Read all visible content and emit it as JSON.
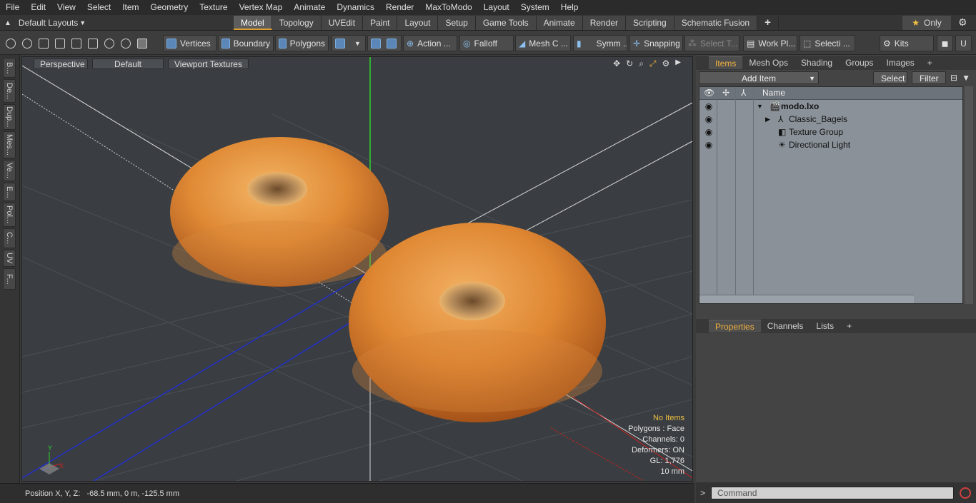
{
  "menu": [
    "File",
    "Edit",
    "View",
    "Select",
    "Item",
    "Geometry",
    "Texture",
    "Vertex Map",
    "Animate",
    "Dynamics",
    "Render",
    "MaxToModo",
    "Layout",
    "System",
    "Help"
  ],
  "layouts_label": "Default Layouts",
  "tabs": [
    {
      "label": "Model",
      "active": true
    },
    {
      "label": "Topology"
    },
    {
      "label": "UVEdit"
    },
    {
      "label": "Paint"
    },
    {
      "label": "Layout"
    },
    {
      "label": "Setup"
    },
    {
      "label": "Game Tools"
    },
    {
      "label": "Animate"
    },
    {
      "label": "Render"
    },
    {
      "label": "Scripting"
    },
    {
      "label": "Schematic Fusion"
    }
  ],
  "only_label": "Only",
  "toolbar": {
    "vertices": "Vertices",
    "boundary": "Boundary",
    "polygons": "Polygons",
    "action": "Action ...",
    "falloff": "Falloff",
    "mesh": "Mesh C ...",
    "symm": "Symm ...",
    "snapping": "Snapping",
    "select_t": "Select T...",
    "work_pl": "Work Pl...",
    "selecti": "Selecti ...",
    "kits": "Kits"
  },
  "left_tabs": [
    "B...",
    "De...",
    "Dup...",
    "Mes...",
    "Ve...",
    "E...",
    "Pol...",
    "C...",
    "UV",
    "F..."
  ],
  "viewport": {
    "view_label": "Perspective",
    "shading_label": "Default",
    "texture_label": "Viewport Textures",
    "info": {
      "no_items": "No Items",
      "polygons": "Polygons : Face",
      "channels": "Channels: 0",
      "deformers": "Deformers: ON",
      "gl": "GL: 1,776",
      "scale": "10 mm"
    }
  },
  "status": {
    "position": "Position X, Y, Z:   -68.5 mm, 0 m, -125.5 mm"
  },
  "panel": {
    "tabs": [
      "Items",
      "Mesh Ops",
      "Shading",
      "Groups",
      "Images"
    ],
    "add_item": "Add Item",
    "select": "Select",
    "filter": "Filter",
    "name_header": "Name",
    "tree": [
      {
        "label": "modo.lxo",
        "bold": true
      },
      {
        "label": "Classic_Bagels"
      },
      {
        "label": "Texture Group"
      },
      {
        "label": "Directional Light"
      }
    ],
    "props_tabs": [
      "Properties",
      "Channels",
      "Lists"
    ],
    "command_placeholder": "Command"
  },
  "colors": {
    "accent": "#e0a030",
    "items_tab": "#f0b040",
    "bagel": "#d98a3a"
  }
}
